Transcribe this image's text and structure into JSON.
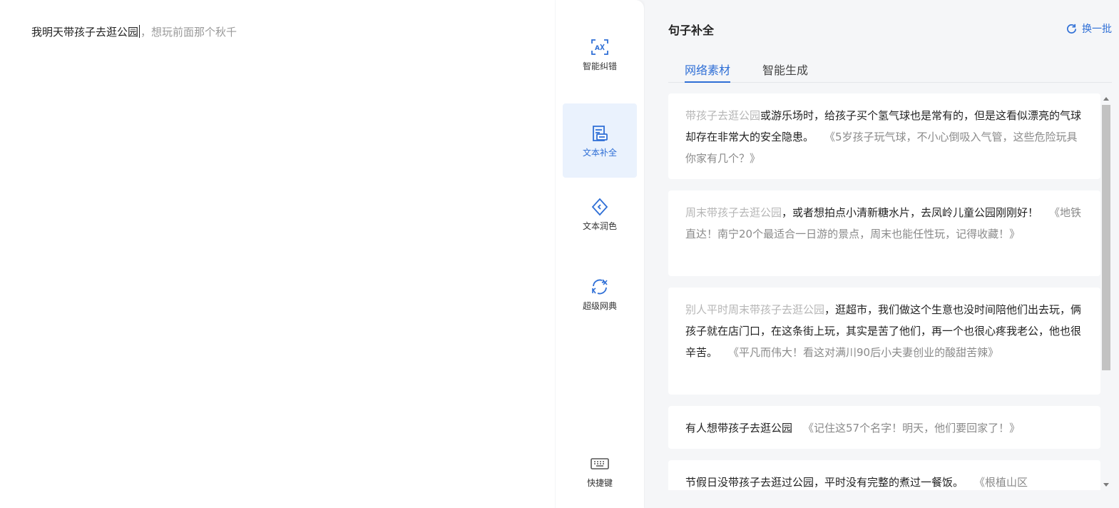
{
  "editor": {
    "typed_text": "我明天带孩子去逛公园",
    "suggestion_text": "，想玩前面那个秋千"
  },
  "tools": [
    {
      "label": "智能纠错",
      "icon": "ai-spellcheck-icon",
      "active": false
    },
    {
      "label": "文本补全",
      "icon": "document-complete-icon",
      "active": true
    },
    {
      "label": "文本润色",
      "icon": "tag-polish-icon",
      "active": false
    },
    {
      "label": "超级网典",
      "icon": "translate-swap-icon",
      "active": false
    },
    {
      "label": "快捷键",
      "icon": "keyboard-icon",
      "active": false
    }
  ],
  "panel": {
    "title": "句子补全",
    "refresh_label": "换一批",
    "tabs": [
      {
        "label": "网络素材",
        "active": true
      },
      {
        "label": "智能生成",
        "active": false
      }
    ],
    "results": [
      {
        "prefix": "带孩子去逛公园",
        "text": "或游乐场时，给孩子买个氢气球也是常有的，但是这看似漂亮的气球却存在非常大的安全隐患。",
        "source": "《5岁孩子玩气球，不小心倒吸入气管，这些危险玩具你家有几个？》"
      },
      {
        "prefix": "周末带孩子去逛公园",
        "text": "，或者想拍点小清新糖水片，去凤岭儿童公园刚刚好！",
        "source": "《地铁直达！南宁20个最适合一日游的景点，周末也能任性玩，记得收藏！》"
      },
      {
        "prefix": "别人平时周末带孩子去逛公园",
        "text": "，逛超市，我们做这个生意也没时间陪他们出去玩，俩孩子就在店门口，在这条街上玩，其实是苦了他们，再一个也很心疼我老公，他也很辛苦。",
        "source": "《平凡而伟大！看这对满川90后小夫妻创业的酸甜苦辣》"
      },
      {
        "prefix": "",
        "text": "有人想带孩子去逛公园",
        "source": "《记住这57个名字！明天，他们要回家了！》"
      },
      {
        "prefix": "",
        "text": "节假日没带孩子去逛过公园，平时没有完整的煮过一餐饭。",
        "source": "《根植山区"
      }
    ]
  },
  "colors": {
    "accent": "#2f6fd6",
    "active_bg": "#eaf2fd",
    "muted_text": "#9a9a9a",
    "panel_bg": "#f5f6f8"
  }
}
